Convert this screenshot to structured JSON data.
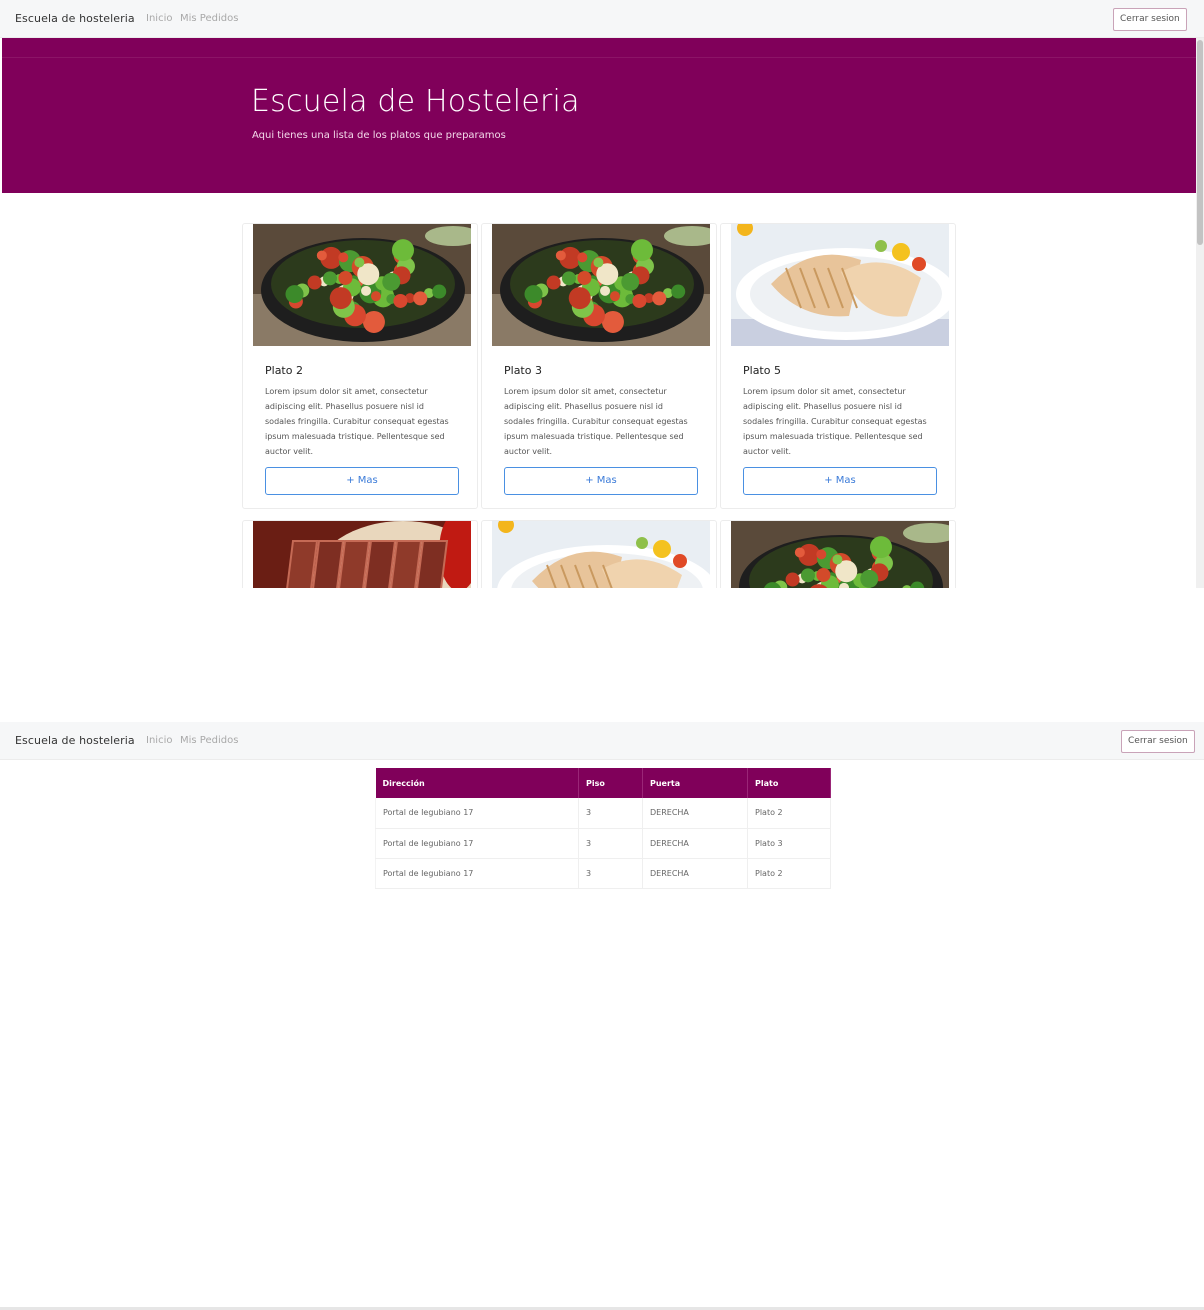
{
  "nav": {
    "brand": "Escuela de hosteleria",
    "links": [
      "Inicio",
      "Mis Pedidos"
    ],
    "logout": "Cerrar sesion"
  },
  "hero": {
    "title": "Escuela de Hosteleria",
    "subtitle": "Aqui tienes una lista de los platos que preparamos"
  },
  "cards": [
    {
      "title": "Plato 2",
      "text": "Lorem ipsum dolor sit amet, consectetur adipiscing elit. Phasellus posuere nisl id sodales fringilla. Curabitur consequat egestas ipsum malesuada tristique. Pellentesque sed auctor velit.",
      "button": "+ Mas",
      "image": "salad"
    },
    {
      "title": "Plato 3",
      "text": "Lorem ipsum dolor sit amet, consectetur adipiscing elit. Phasellus posuere nisl id sodales fringilla. Curabitur consequat egestas ipsum malesuada tristique. Pellentesque sed auctor velit.",
      "button": "+ Mas",
      "image": "salad"
    },
    {
      "title": "Plato 5",
      "text": "Lorem ipsum dolor sit amet, consectetur adipiscing elit. Phasellus posuere nisl id sodales fringilla. Curabitur consequat egestas ipsum malesuada tristique. Pellentesque sed auctor velit.",
      "button": "+ Mas",
      "image": "fish"
    },
    {
      "title": "",
      "text": "",
      "button": "",
      "image": "steak"
    },
    {
      "title": "",
      "text": "",
      "button": "",
      "image": "fish"
    },
    {
      "title": "",
      "text": "",
      "button": "",
      "image": "salad"
    }
  ],
  "orders": {
    "headers": [
      "Dirección",
      "Piso",
      "Puerta",
      "Plato"
    ],
    "rows": [
      [
        "Portal de Iegubiano 17",
        "3",
        "DERECHA",
        "Plato 2"
      ],
      [
        "Portal de Iegubiano 17",
        "3",
        "DERECHA",
        "Plato 3"
      ],
      [
        "Portal de Iegubiano 17",
        "3",
        "DERECHA",
        "Plato 2"
      ]
    ]
  },
  "colors": {
    "brand": "#80005a",
    "button_border": "#4a90e2",
    "navbar_bg": "#f6f7f8"
  }
}
